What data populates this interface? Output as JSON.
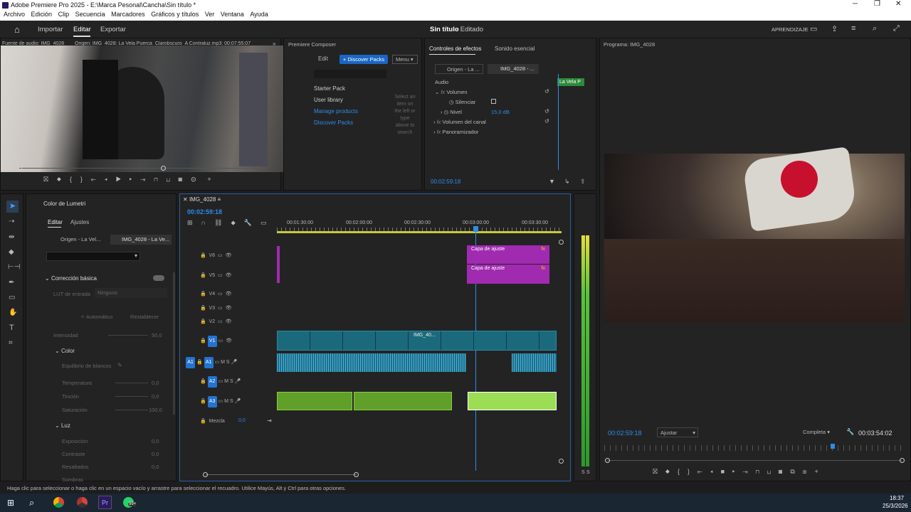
{
  "window": {
    "title": "Adobe Premiere Pro 2025 - E:\\Marca Pesonal\\Cancha\\Sin título *",
    "app_icon": "premiere-icon"
  },
  "menu": [
    "Archivo",
    "Edición",
    "Clip",
    "Secuencia",
    "Marcadores",
    "Gráficos y títulos",
    "Ver",
    "Ventana",
    "Ayuda"
  ],
  "nav": {
    "home_icon": "home-icon",
    "tabs": [
      "Importar",
      "Editar",
      "Exportar"
    ],
    "active": "Editar",
    "project_title": "Sin título",
    "project_status": "- Editado",
    "right_label": "APRENDIZAJE"
  },
  "source": {
    "header": "Fuente de audio: IMG_4028",
    "header2": "Origen: IMG_4028: La Vela Puerca_Clarobscuro_A Contraluz.mp3: 00:07:55:07"
  },
  "composer": {
    "title": "Premiere Composer",
    "edit": "Edit",
    "discover": "+ Discover Packs",
    "menu": "Menu",
    "items": [
      "Starter Pack",
      "User library",
      "Manage products",
      "Discover Packs"
    ],
    "hint": "Select an item on the left or type above to search"
  },
  "effects": {
    "tabs": [
      "Controles de efectos",
      "Sonido esencial"
    ],
    "origin": "Origen - La ...",
    "clip": "IMG_4028 - ...",
    "section": "Audio",
    "clip_chip": "La Vela P",
    "rows": [
      {
        "label": "Volumen",
        "fx": true
      },
      {
        "label": "Silenciar"
      },
      {
        "label": "Nivel",
        "value": "15,0 dB"
      },
      {
        "label": "Volumen del canal",
        "fx": true
      },
      {
        "label": "Panoramizador",
        "fx": true
      }
    ],
    "time": "00:02:59:18"
  },
  "program": {
    "title": "Programa: IMG_4028",
    "time": "00:02:59:18",
    "fit": "Ajustar",
    "quality": "Completa",
    "duration": "00:03:54:02"
  },
  "lumetri": {
    "title": "Color de Lumetri",
    "tabs": [
      "Editar",
      "Ajustes"
    ],
    "sources": [
      "Origen - La Vel...",
      "IMG_4028 - La Ve..."
    ],
    "section": "Corrección básica",
    "lut_label": "LUT de entrada",
    "lut_value": "Ninguno",
    "auto": "Automático",
    "reset": "Restablecer",
    "intensity": "Intensidad",
    "intensity_val": "50,0",
    "color_section": "Color",
    "white_balance": "Equilibrio de blancos",
    "sliders": [
      {
        "label": "Temperatura",
        "value": "0,0"
      },
      {
        "label": "Tinción",
        "value": "0,0"
      },
      {
        "label": "Saturación",
        "value": "100,0"
      }
    ],
    "light_section": "Luz",
    "light_sliders": [
      {
        "label": "Exposición",
        "value": "0,0"
      },
      {
        "label": "Contraste",
        "value": "0,0"
      },
      {
        "label": "Resaltados",
        "value": "0,0"
      },
      {
        "label": "Sombras",
        "value": "0,0"
      }
    ]
  },
  "timeline": {
    "tab": "IMG_4028",
    "timecode": "00:02:59:18",
    "ruler": [
      "00:01:30:00",
      "00:02:00:00",
      "00:02:30:00",
      "00:03:00:00",
      "00:03:30:00"
    ],
    "video_tracks": [
      "V6",
      "V5",
      "V4",
      "V3",
      "V2",
      "V1"
    ],
    "audio_tracks": [
      "A1",
      "A2",
      "A3"
    ],
    "mix": "Mezcla",
    "mix_value": "0,0",
    "adjust_label": "Capa de ajuste",
    "clip_label": "IMG_40...",
    "fx": "fx"
  },
  "status": "Haga clic para seleccionar o haga clic en un espacio vacío y arrastre para seleccionar el recuadro. Utilice Mayús, Alt y Ctrl para otras opciones.",
  "taskbar": {
    "time": "18:37",
    "date": "25/3/2026",
    "badge": "99+"
  },
  "meter_labels": [
    "S",
    "S"
  ],
  "colors": {
    "accent": "#2d8ceb",
    "purple": "#a02bb0",
    "green": "#6fb52c",
    "teal": "#1b6a7c"
  }
}
